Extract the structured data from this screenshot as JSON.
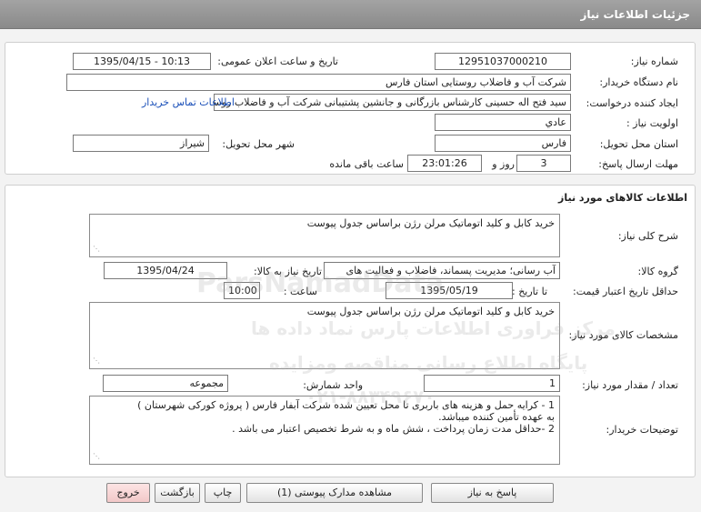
{
  "header": {
    "title": "جزئیات اطلاعات نیاز"
  },
  "need": {
    "number_label": "شماره نیاز:",
    "number_value": "12951037000210",
    "announce_label": "تاریخ و ساعت اعلان عمومی:",
    "announce_value": "1395/04/15 - 10:13",
    "buyer_label": "نام دستگاه خریدار:",
    "buyer_value": "شرکت آب و فاضلاب روستایی استان فارس",
    "creator_label": "ایجاد کننده درخواست:",
    "creator_value": "سید فتح اله  حسینی  کارشناس بازرگانی و جانشین پشتیبانی شرکت آب و فاضلاب روستایی استان فارس",
    "contact_link": "اطلاعات تماس خریدار",
    "priority_label": "اولویت نیاز :",
    "priority_value": "عادي",
    "province_label": "استان محل تحویل:",
    "province_value": "فارس",
    "city_label": "شهر محل تحویل:",
    "city_value": "شیراز",
    "deadline_label": "مهلت ارسال پاسخ:",
    "deadline_days": "3",
    "days_label": "روز و",
    "deadline_time": "23:01:26",
    "remaining_label": "ساعت باقی مانده"
  },
  "goods": {
    "section_title": "اطلاعات کالاهای مورد نیاز",
    "summary_label": "شرح کلی نیاز:",
    "summary_value": "خرید کابل و کلید اتوماتیک مرلن رژن براساس جدول پیوست",
    "group_label": "گروه کالا:",
    "group_value": "آب رسانی؛ مدیریت پسماند، فاضلاب و فعالیت های",
    "need_date_label": "تاریخ نیاز به کالا:",
    "need_date_value": "1395/04/24",
    "min_price_label": "حداقل تاریخ اعتبار قیمت:",
    "to_date_label": "تا تاریخ :",
    "to_date_value": "1395/05/19",
    "time_label": "ساعت :",
    "time_value": "10:00",
    "spec_label": "مشخصات کالای مورد نیاز:",
    "spec_value": "خرید کابل و کلید اتوماتیک مرلن رژن براساس جدول پیوست",
    "qty_label": "تعداد / مقدار مورد نیاز:",
    "qty_value": "1",
    "unit_label": "واحد شمارش:",
    "unit_value": "مجموعه",
    "notes_label": "توضیحات خریدار:",
    "notes_value": "1 - کرایه حمل و هزینه های باربری تا محل تعیین شده شرکت آبفار فارس ( پروژه کورکی شهرستان )\nبه عهده تأمین کننده میباشد.\n2 -حداقل مدت زمان پرداخت ، شش ماه و به شرط تخصیص اعتبار می باشد ."
  },
  "watermark": {
    "line1": "مرکز فراوری اطلاعات پارس نماد داده ها",
    "line2": "پایگاه اطلاع رسانی مناقصه ومزایده",
    "line3": "۰۲۱-۸۸۳۴۹۶۷۰",
    "brand": "ParsNamadData"
  },
  "buttons": {
    "reply": "پاسخ به نیاز",
    "attachments": "مشاهده مدارک پیوستی (1)",
    "print": "چاپ",
    "back": "بازگشت",
    "exit": "خروج"
  }
}
